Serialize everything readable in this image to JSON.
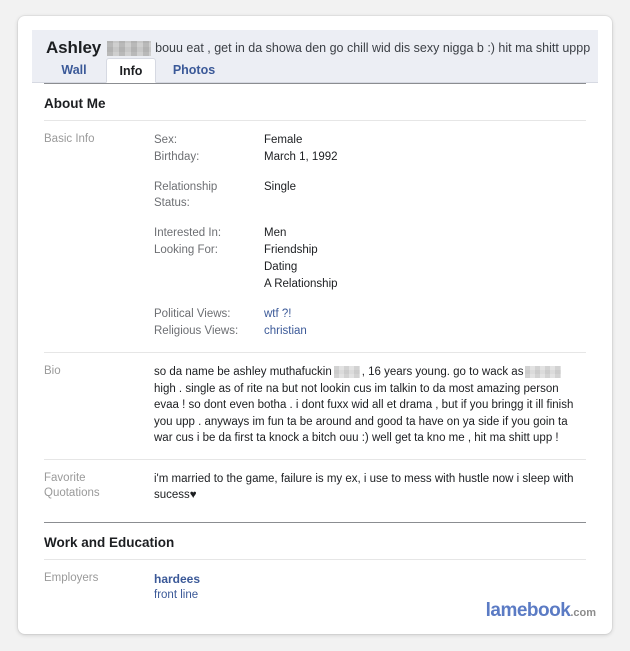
{
  "header": {
    "profile_name": "Ashley",
    "name_redacted": true,
    "status_text": "bouu eat , get in da showa den go chill wid dis sexy nigga b :) hit ma shitt uppp !"
  },
  "tabs": [
    {
      "label": "Wall",
      "active": false
    },
    {
      "label": "Info",
      "active": true
    },
    {
      "label": "Photos",
      "active": false
    }
  ],
  "sections": {
    "about_me": {
      "title": "About Me",
      "basic_info": {
        "label": "Basic Info",
        "fields": [
          {
            "key": "Sex:",
            "value": "Female",
            "link": false
          },
          {
            "key": "Birthday:",
            "value": "March 1, 1992",
            "link": false
          },
          {
            "key": "Relationship Status:",
            "value": "Single",
            "link": false
          },
          {
            "key": "Interested In:",
            "value": "Men",
            "link": false
          },
          {
            "key": "Looking For:",
            "value": "Friendship",
            "link": false
          },
          {
            "key": "",
            "value": "Dating",
            "link": false
          },
          {
            "key": "",
            "value": "A Relationship",
            "link": false
          },
          {
            "key": "Political Views:",
            "value": "wtf ?!",
            "link": true
          },
          {
            "key": "Religious Views:",
            "value": "christian",
            "link": true
          }
        ]
      },
      "bio": {
        "label": "Bio",
        "part1": "so da name be ashley muthafuckin",
        "part2": ", 16 years young. go to wack as",
        "part3": "high . single as of rite na but not lookin cus im talkin to da most amazing person evaa ! so dont even botha . i dont fuxx wid all et drama , but if you bringg it ill finish you upp . anyways im fun ta be around and good ta have on ya side if you goin ta war cus i be da first ta knock a bitch ouu :) well get ta kno me , hit ma shitt upp !"
      },
      "favorite_quotations": {
        "label_line1": "Favorite",
        "label_line2": "Quotations",
        "text": "i'm married to the game, failure is my ex, i use to mess with hustle now i sleep with sucess♥"
      }
    },
    "work_and_education": {
      "title": "Work and Education",
      "employers": {
        "label": "Employers",
        "name": "hardees",
        "role": "front line"
      }
    }
  },
  "watermark": {
    "brand": "lamebook",
    "tld": ".com"
  },
  "colors": {
    "link": "#3b5998",
    "header_bg": "#eceef4",
    "label_gray": "#9a9a9a",
    "watermark_blue": "#5b7bc4"
  }
}
